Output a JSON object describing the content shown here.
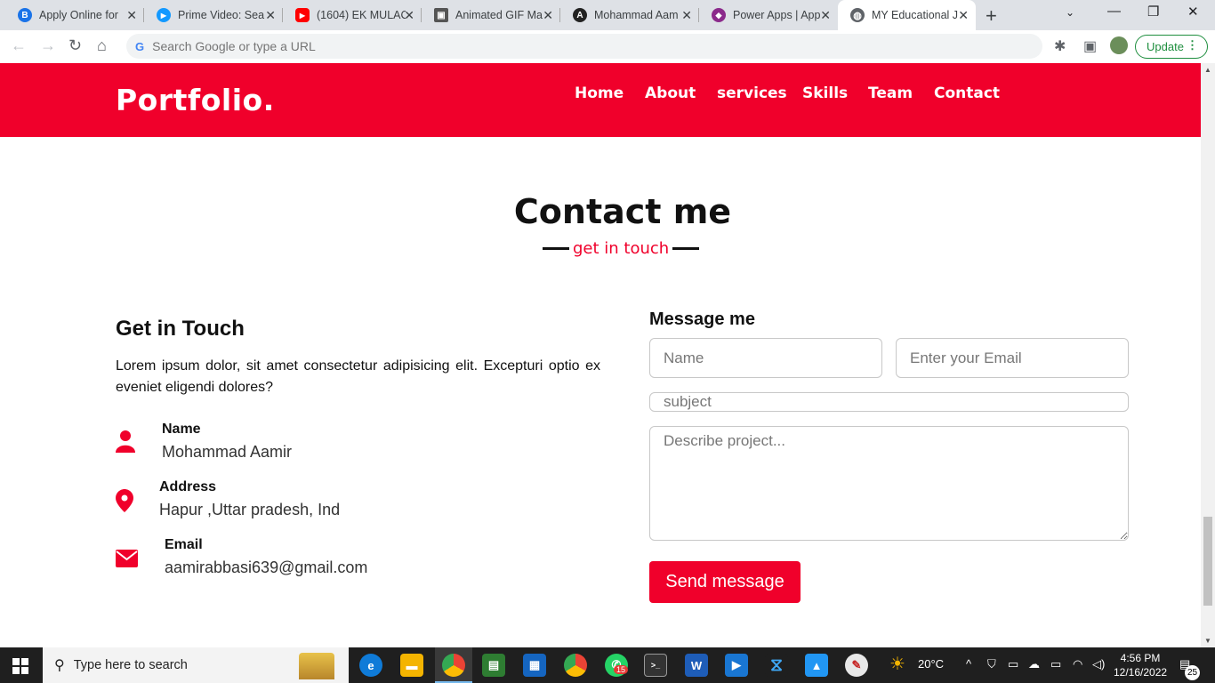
{
  "browser": {
    "tabs": [
      {
        "title": "Apply Online for",
        "favicon_color": "#1a73e8",
        "favicon_char": "B"
      },
      {
        "title": "Prime Video: Sea",
        "favicon_color": "#1399ff",
        "favicon_char": "▶"
      },
      {
        "title": "(1604) EK MULAC",
        "favicon_color": "#ff0000",
        "favicon_char": "▶"
      },
      {
        "title": "Animated GIF Ma",
        "favicon_color": "#555555",
        "favicon_char": "▣"
      },
      {
        "title": "Mohammad Aam",
        "favicon_color": "#222222",
        "favicon_char": "A"
      },
      {
        "title": "Power Apps | App",
        "favicon_color": "#8b2a8b",
        "favicon_char": "◆"
      },
      {
        "title": "MY Educational J",
        "favicon_color": "#5f6368",
        "favicon_char": "◍"
      }
    ],
    "active_tab_index": 6,
    "omnibox_placeholder": "Search Google or type a URL",
    "update_label": "Update"
  },
  "site": {
    "brand": "Portfolio.",
    "accent_color": "#f0002b",
    "menu": [
      "Home",
      "About",
      "services",
      "Skills",
      "Team",
      "Contact"
    ]
  },
  "contact": {
    "title": "Contact me",
    "subtitle": "get in touch",
    "left_heading": "Get in Touch",
    "left_text": "Lorem ipsum dolor, sit amet consectetur adipisicing elit. Excepturi optio ex eveniet eligendi dolores?",
    "info": [
      {
        "label": "Name",
        "value": "Mohammad Aamir",
        "icon": "user-icon"
      },
      {
        "label": "Address",
        "value": "Hapur ,Uttar pradesh, Ind",
        "icon": "map-pin-icon"
      },
      {
        "label": "Email",
        "value": "aamirabbasi639@gmail.com",
        "icon": "envelope-icon"
      }
    ],
    "form_heading": "Message me",
    "name_placeholder": "Name",
    "email_placeholder": "Enter your Email",
    "subject_placeholder": "subject",
    "message_placeholder": "Describe project...",
    "send_label": "Send message"
  },
  "taskbar": {
    "search_placeholder": "Type here to search",
    "weather": "20°C",
    "time": "4:56 PM",
    "date": "12/16/2022",
    "whatsapp_badge": "15",
    "notification_count": "25"
  }
}
